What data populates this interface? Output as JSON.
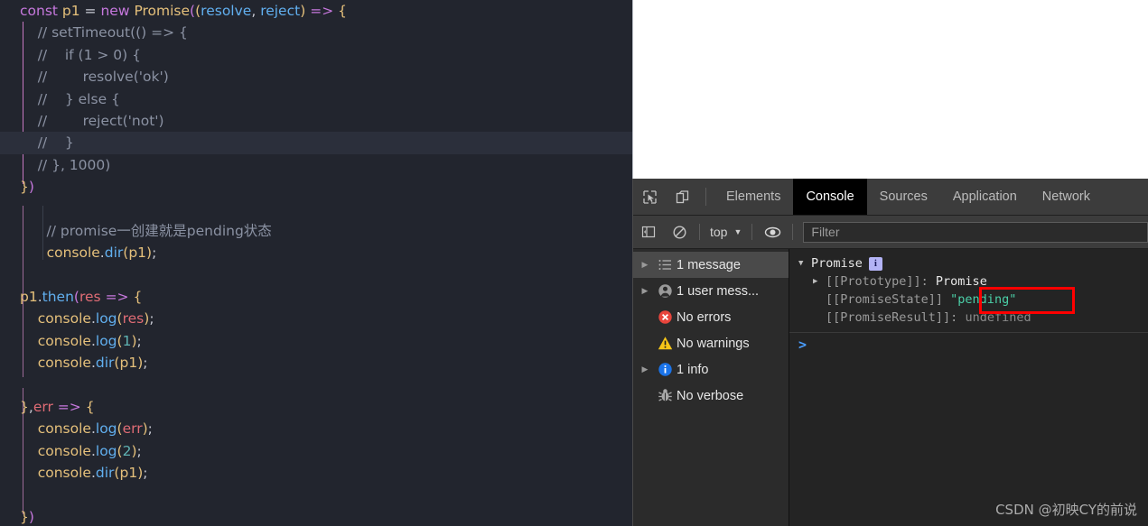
{
  "editor": {
    "lines": [
      {
        "id": "l1",
        "indent": 0,
        "current": false,
        "tokens": [
          {
            "t": "const ",
            "c": "kw"
          },
          {
            "t": "p1",
            "c": "var"
          },
          {
            "t": " = ",
            "c": "op"
          },
          {
            "t": "new ",
            "c": "kw"
          },
          {
            "t": "Promise",
            "c": "var"
          },
          {
            "t": "(",
            "c": "punc"
          },
          {
            "t": "(",
            "c": "punc2"
          },
          {
            "t": "resolve",
            "c": "param"
          },
          {
            "t": ", ",
            "c": "op"
          },
          {
            "t": "reject",
            "c": "param"
          },
          {
            "t": ")",
            "c": "punc2"
          },
          {
            "t": " ",
            "c": "op"
          },
          {
            "t": "=>",
            "c": "arrow"
          },
          {
            "t": " ",
            "c": "op"
          },
          {
            "t": "{",
            "c": "punc2"
          }
        ]
      },
      {
        "id": "l2",
        "indent": 0,
        "current": false,
        "tokens": [
          {
            "t": "    // setTimeout(() => {",
            "c": "cmt"
          }
        ]
      },
      {
        "id": "l3",
        "indent": 0,
        "current": false,
        "tokens": [
          {
            "t": "    //    if (1 > 0) {",
            "c": "cmt"
          }
        ]
      },
      {
        "id": "l4",
        "indent": 0,
        "current": false,
        "tokens": [
          {
            "t": "    //        resolve('ok')",
            "c": "cmt"
          }
        ]
      },
      {
        "id": "l5",
        "indent": 0,
        "current": false,
        "tokens": [
          {
            "t": "    //    } else {",
            "c": "cmt"
          }
        ]
      },
      {
        "id": "l6",
        "indent": 0,
        "current": false,
        "tokens": [
          {
            "t": "    //        reject('not')",
            "c": "cmt"
          }
        ]
      },
      {
        "id": "l7",
        "indent": 0,
        "current": true,
        "tokens": [
          {
            "t": "    //    }",
            "c": "cmt"
          }
        ]
      },
      {
        "id": "l8",
        "indent": 0,
        "current": false,
        "tokens": [
          {
            "t": "    // }, 1000)",
            "c": "cmt"
          }
        ]
      },
      {
        "id": "l9",
        "indent": 0,
        "current": false,
        "tokens": [
          {
            "t": "}",
            "c": "punc2"
          },
          {
            "t": ")",
            "c": "punc"
          }
        ]
      },
      {
        "id": "l10",
        "indent": 0,
        "current": false,
        "tokens": []
      },
      {
        "id": "l11",
        "indent": 0,
        "current": false,
        "tokens": [
          {
            "t": "      // promise一创建就是pending状态",
            "c": "cmt"
          }
        ]
      },
      {
        "id": "l12",
        "indent": 0,
        "current": false,
        "tokens": [
          {
            "t": "      ",
            "c": "op"
          },
          {
            "t": "console",
            "c": "var"
          },
          {
            "t": ".",
            "c": "op"
          },
          {
            "t": "dir",
            "c": "fn"
          },
          {
            "t": "(",
            "c": "punc2"
          },
          {
            "t": "p1",
            "c": "var"
          },
          {
            "t": ")",
            "c": "punc2"
          },
          {
            "t": ";",
            "c": "op"
          }
        ]
      },
      {
        "id": "l13",
        "indent": 0,
        "current": false,
        "tokens": []
      },
      {
        "id": "l14",
        "indent": 0,
        "current": false,
        "tokens": [
          {
            "t": "p1",
            "c": "var"
          },
          {
            "t": ".",
            "c": "op"
          },
          {
            "t": "then",
            "c": "fn"
          },
          {
            "t": "(",
            "c": "punc"
          },
          {
            "t": "res",
            "c": "red"
          },
          {
            "t": " ",
            "c": "op"
          },
          {
            "t": "=>",
            "c": "arrow"
          },
          {
            "t": " ",
            "c": "op"
          },
          {
            "t": "{",
            "c": "punc2"
          }
        ]
      },
      {
        "id": "l15",
        "indent": 0,
        "current": false,
        "tokens": [
          {
            "t": "    ",
            "c": "op"
          },
          {
            "t": "console",
            "c": "var"
          },
          {
            "t": ".",
            "c": "op"
          },
          {
            "t": "log",
            "c": "fn"
          },
          {
            "t": "(",
            "c": "punc2"
          },
          {
            "t": "res",
            "c": "red"
          },
          {
            "t": ")",
            "c": "punc2"
          },
          {
            "t": ";",
            "c": "op"
          }
        ]
      },
      {
        "id": "l16",
        "indent": 0,
        "current": false,
        "tokens": [
          {
            "t": "    ",
            "c": "op"
          },
          {
            "t": "console",
            "c": "var"
          },
          {
            "t": ".",
            "c": "op"
          },
          {
            "t": "log",
            "c": "fn"
          },
          {
            "t": "(",
            "c": "punc2"
          },
          {
            "t": "1",
            "c": "num"
          },
          {
            "t": ")",
            "c": "punc2"
          },
          {
            "t": ";",
            "c": "op"
          }
        ]
      },
      {
        "id": "l17",
        "indent": 0,
        "current": false,
        "tokens": [
          {
            "t": "    ",
            "c": "op"
          },
          {
            "t": "console",
            "c": "var"
          },
          {
            "t": ".",
            "c": "op"
          },
          {
            "t": "dir",
            "c": "fn"
          },
          {
            "t": "(",
            "c": "punc2"
          },
          {
            "t": "p1",
            "c": "var"
          },
          {
            "t": ")",
            "c": "punc2"
          },
          {
            "t": ";",
            "c": "op"
          }
        ]
      },
      {
        "id": "l18",
        "indent": 0,
        "current": false,
        "tokens": []
      },
      {
        "id": "l19",
        "indent": 0,
        "current": false,
        "tokens": [
          {
            "t": "}",
            "c": "punc2"
          },
          {
            "t": ",",
            "c": "op"
          },
          {
            "t": "err",
            "c": "red"
          },
          {
            "t": " ",
            "c": "op"
          },
          {
            "t": "=>",
            "c": "arrow"
          },
          {
            "t": " ",
            "c": "op"
          },
          {
            "t": "{",
            "c": "punc2"
          }
        ]
      },
      {
        "id": "l20",
        "indent": 0,
        "current": false,
        "tokens": [
          {
            "t": "    ",
            "c": "op"
          },
          {
            "t": "console",
            "c": "var"
          },
          {
            "t": ".",
            "c": "op"
          },
          {
            "t": "log",
            "c": "fn"
          },
          {
            "t": "(",
            "c": "punc2"
          },
          {
            "t": "err",
            "c": "red"
          },
          {
            "t": ")",
            "c": "punc2"
          },
          {
            "t": ";",
            "c": "op"
          }
        ]
      },
      {
        "id": "l21",
        "indent": 0,
        "current": false,
        "tokens": [
          {
            "t": "    ",
            "c": "op"
          },
          {
            "t": "console",
            "c": "var"
          },
          {
            "t": ".",
            "c": "op"
          },
          {
            "t": "log",
            "c": "fn"
          },
          {
            "t": "(",
            "c": "punc2"
          },
          {
            "t": "2",
            "c": "num"
          },
          {
            "t": ")",
            "c": "punc2"
          },
          {
            "t": ";",
            "c": "op"
          }
        ]
      },
      {
        "id": "l22",
        "indent": 0,
        "current": false,
        "tokens": [
          {
            "t": "    ",
            "c": "op"
          },
          {
            "t": "console",
            "c": "var"
          },
          {
            "t": ".",
            "c": "op"
          },
          {
            "t": "dir",
            "c": "fn"
          },
          {
            "t": "(",
            "c": "punc2"
          },
          {
            "t": "p1",
            "c": "var"
          },
          {
            "t": ")",
            "c": "punc2"
          },
          {
            "t": ";",
            "c": "op"
          }
        ]
      },
      {
        "id": "l23",
        "indent": 0,
        "current": false,
        "tokens": []
      },
      {
        "id": "l24",
        "indent": 0,
        "current": false,
        "tokens": [
          {
            "t": "}",
            "c": "punc2"
          },
          {
            "t": ")",
            "c": "punc"
          }
        ]
      }
    ]
  },
  "devtools": {
    "tabs": [
      {
        "label": "Elements",
        "active": false
      },
      {
        "label": "Console",
        "active": true
      },
      {
        "label": "Sources",
        "active": false
      },
      {
        "label": "Application",
        "active": false
      },
      {
        "label": "Network",
        "active": false
      }
    ],
    "toolbar": {
      "context_label": "top",
      "filter_placeholder": "Filter"
    },
    "sidebar": {
      "items": [
        {
          "label": "1 message",
          "icon": "list-icon",
          "expandable": true,
          "selected": true
        },
        {
          "label": "1 user mess...",
          "icon": "user-icon",
          "expandable": true,
          "selected": false
        },
        {
          "label": "No errors",
          "icon": "error-icon",
          "expandable": false,
          "selected": false
        },
        {
          "label": "No warnings",
          "icon": "warning-icon",
          "expandable": false,
          "selected": false
        },
        {
          "label": "1 info",
          "icon": "info-icon",
          "expandable": true,
          "selected": false
        },
        {
          "label": "No verbose",
          "icon": "bug-icon",
          "expandable": false,
          "selected": false
        }
      ]
    },
    "console": {
      "object_name": "Promise",
      "info_badge": "i",
      "rows": [
        {
          "key": "[[Prototype]]:",
          "value": "Promise",
          "value_type": "proto",
          "expandable": true
        },
        {
          "key": "[[PromiseState]]",
          "value": "\"pending\"",
          "value_type": "string",
          "expandable": false
        },
        {
          "key": "[[PromiseResult]]:",
          "value": "undefined",
          "value_type": "undefined",
          "expandable": false
        }
      ],
      "prompt": ">"
    }
  },
  "watermark": "CSDN @初映CY的前说",
  "colors": {
    "accent_red": "#ff0000",
    "string_green": "#4bd0a8",
    "prompt_blue": "#4a9eff"
  }
}
